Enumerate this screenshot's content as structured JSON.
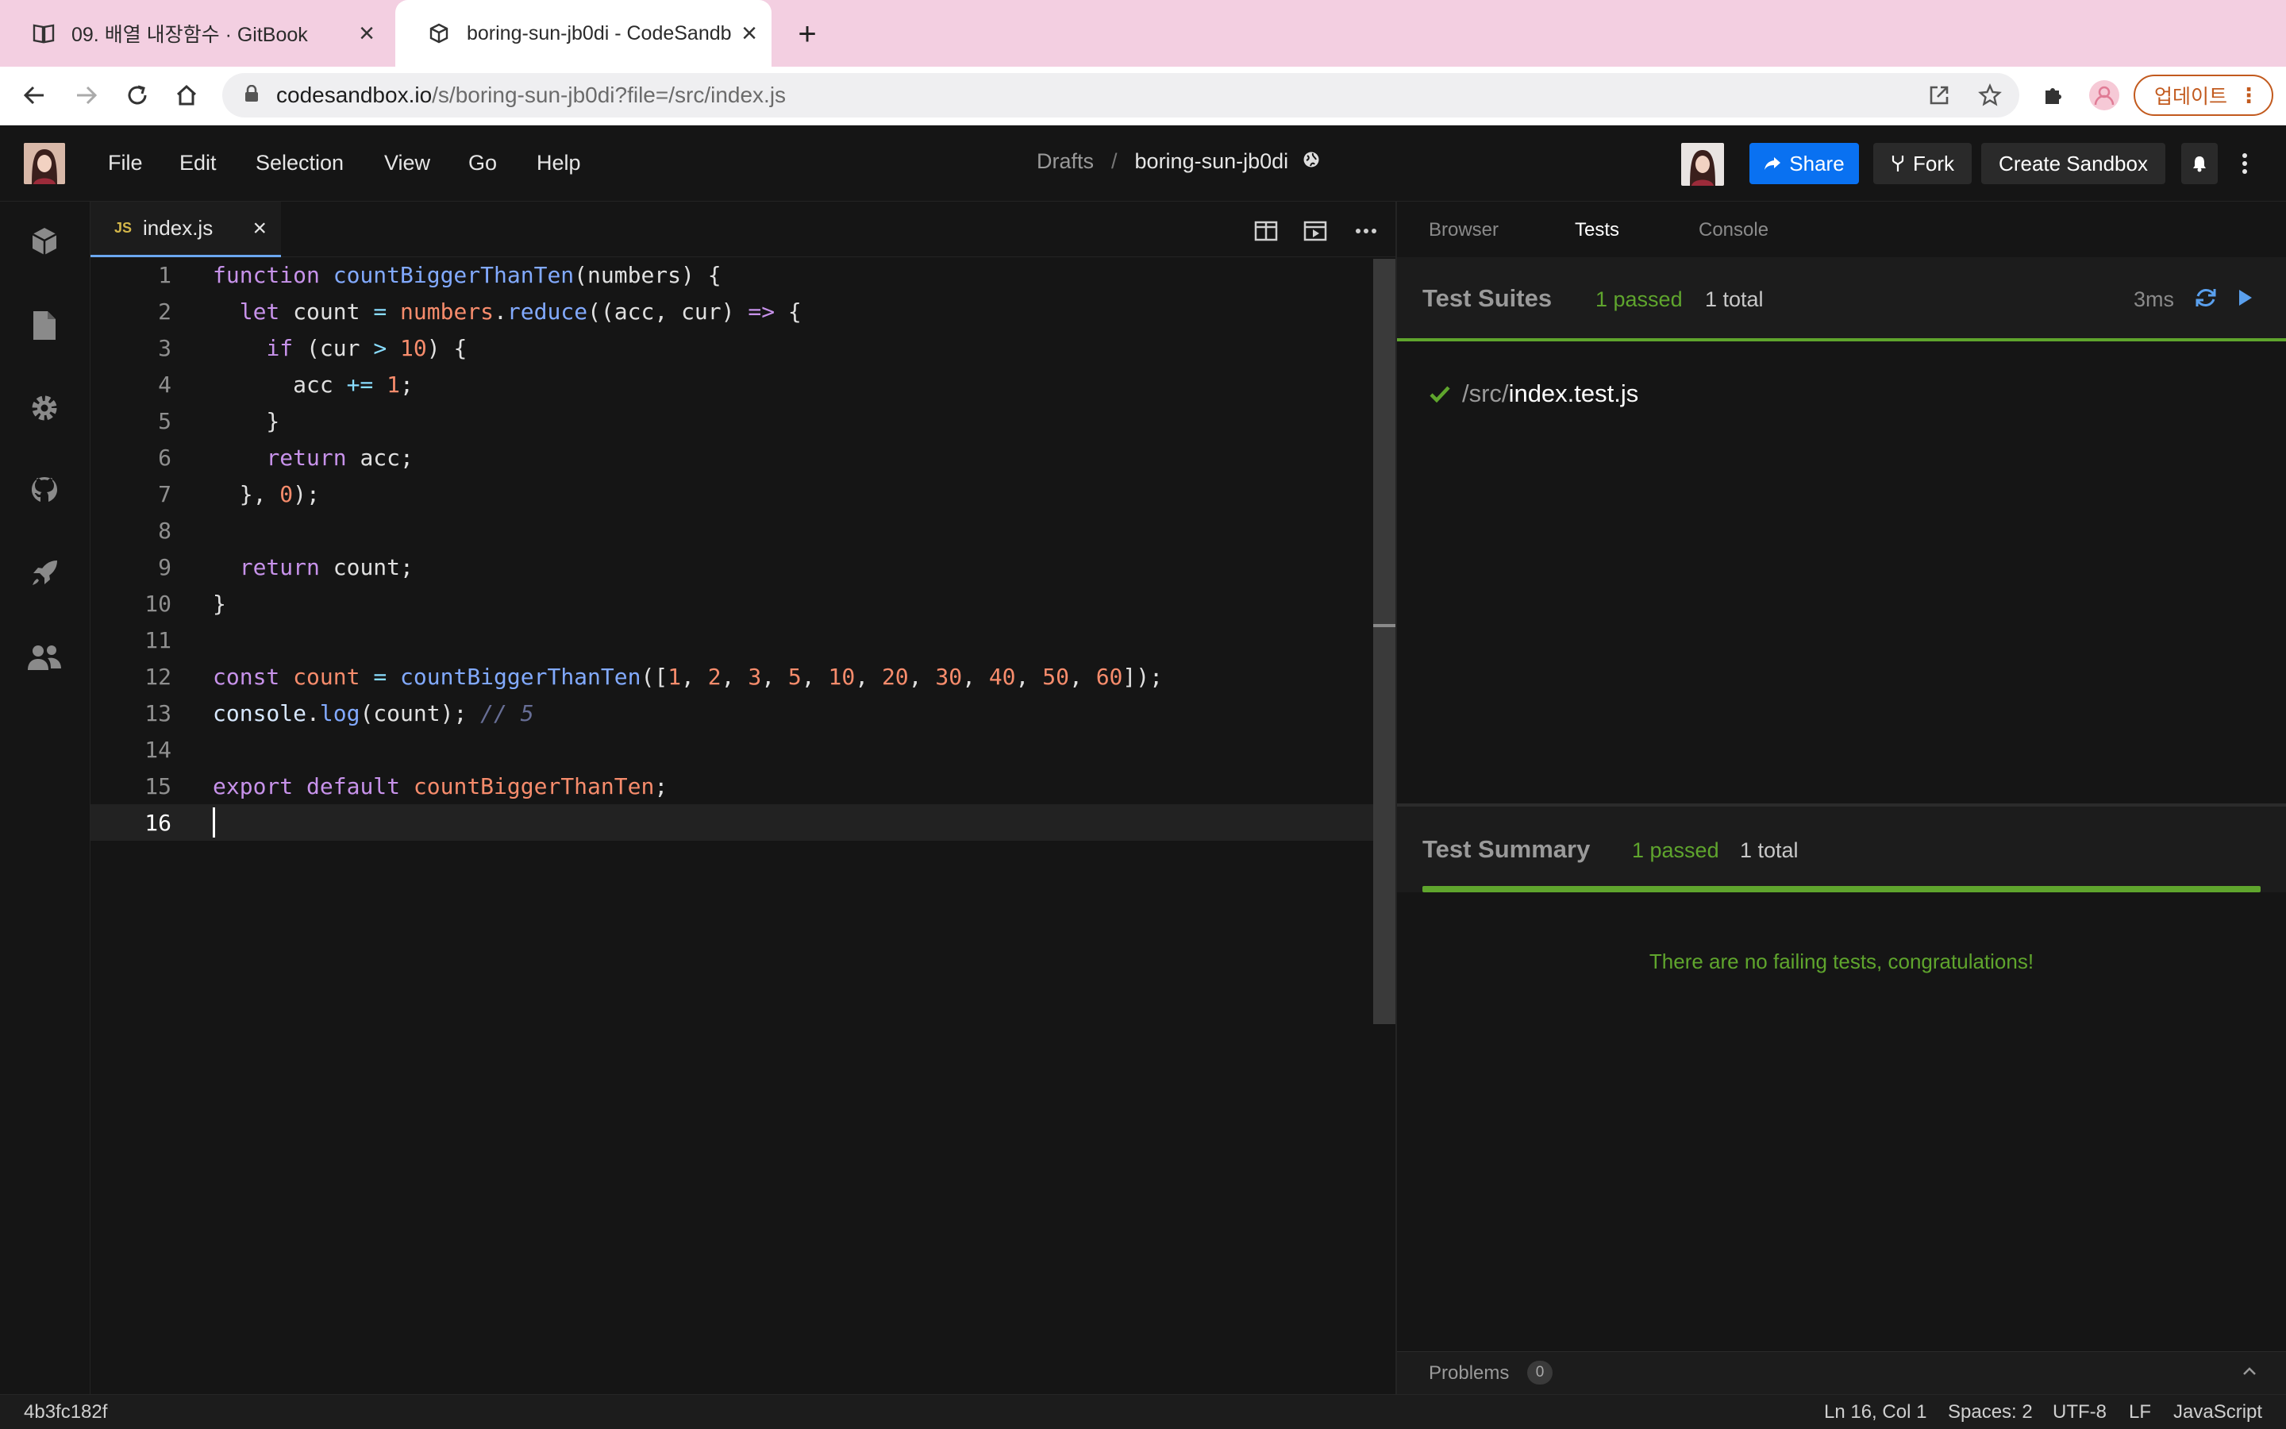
{
  "browser": {
    "tabs": [
      {
        "title": "09. 배열 내장함수 · GitBook",
        "icon": "book-icon"
      },
      {
        "title": "boring-sun-jb0di - CodeSandb",
        "icon": "codesandbox-cube-icon"
      }
    ],
    "url_host": "codesandbox.io",
    "url_path": "/s/boring-sun-jb0di?file=/src/index.js",
    "update_label": "업데이트"
  },
  "app": {
    "menu": [
      "File",
      "Edit",
      "Selection",
      "View",
      "Go",
      "Help"
    ],
    "breadcrumb": {
      "folder": "Drafts",
      "separator": "/",
      "sandbox": "boring-sun-jb0di"
    },
    "buttons": {
      "share": "Share",
      "fork": "Fork",
      "create": "Create Sandbox"
    }
  },
  "editor": {
    "file_tab": {
      "badge": "JS",
      "name": "index.js"
    },
    "line_numbers": [
      "1",
      "2",
      "3",
      "4",
      "5",
      "6",
      "7",
      "8",
      "9",
      "10",
      "11",
      "12",
      "13",
      "14",
      "15",
      "16"
    ],
    "active_line": 16
  },
  "right_panel": {
    "tabs": [
      "Browser",
      "Tests",
      "Console"
    ],
    "active_tab": "Tests",
    "suites": {
      "title": "Test Suites",
      "passed": "1 passed",
      "total": "1 total",
      "time": "3ms",
      "file_dir": "/src/",
      "file_name": "index.test.js"
    },
    "summary": {
      "title": "Test Summary",
      "passed": "1 passed",
      "total": "1 total",
      "message": "There are no failing tests, congratulations!"
    },
    "problems": {
      "label": "Problems",
      "count": "0"
    }
  },
  "status_bar": {
    "commit": "4b3fc182f",
    "position": "Ln 16, Col 1",
    "spaces": "Spaces: 2",
    "encoding": "UTF-8",
    "eol": "LF",
    "language": "JavaScript"
  },
  "colors": {
    "accent": "#0971f1",
    "pass": "#5fa52d",
    "tab_strip": "#f3cfe1"
  }
}
